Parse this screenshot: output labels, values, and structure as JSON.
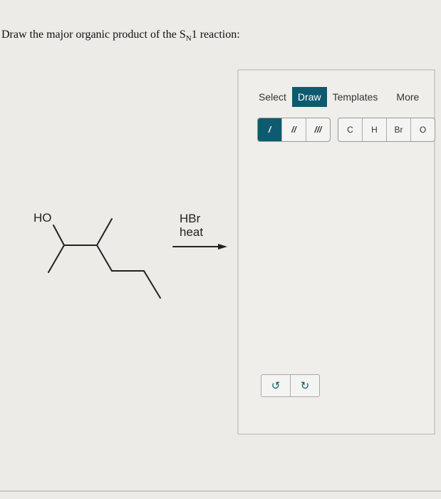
{
  "question": {
    "prefix": "Draw the major organic product of the S",
    "sub": "N",
    "suffix": "1 reaction:"
  },
  "reactant": {
    "label": "HO"
  },
  "reagents": {
    "line1": "HBr",
    "line2": "heat"
  },
  "editor": {
    "tabs": [
      {
        "label": "Select"
      },
      {
        "label": "Draw",
        "active": true
      },
      {
        "label": "Templates"
      },
      {
        "label": "More"
      }
    ],
    "bonds": [
      {
        "label": "/",
        "selected": true
      },
      {
        "label": "//"
      },
      {
        "label": "///"
      }
    ],
    "atoms": [
      "C",
      "H",
      "Br",
      "O"
    ],
    "history": {
      "undo": "↺",
      "redo": "↻"
    }
  },
  "colors": {
    "accent": "#0e5a6e"
  }
}
